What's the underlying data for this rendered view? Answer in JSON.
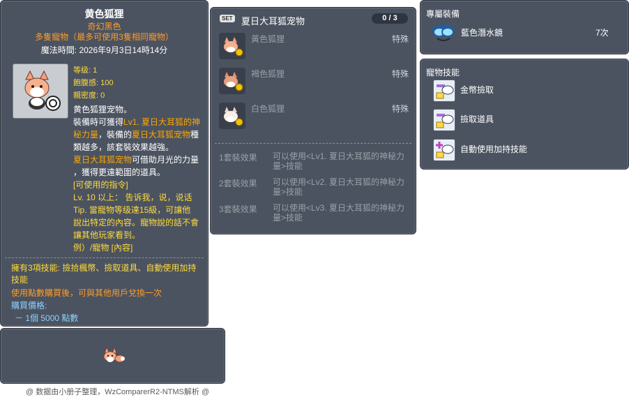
{
  "item_id": "05002251",
  "main": {
    "title": "黄色狐狸",
    "rarity": "奇幻黑色",
    "subtitle": "多隻寵物（最多可使用3隻相同寵物）",
    "magic_time": "魔法時間: 2026年9月3日14時14分",
    "stats": [
      "等级: 1",
      "飽腹感: 100",
      "親密度: 0"
    ],
    "desc": {
      "l1": "黄色狐狸宠物。",
      "l2a": "裝備時可獲得",
      "l2b": "Lv1. 夏日大耳狐的神",
      "l3a": "秘力量",
      "l3b": "，裝備的",
      "l3c": "夏日大耳狐宠物",
      "l3d": "種",
      "l4": "類越多，該套裝效果越強。",
      "l5a": "夏日大耳狐宠物",
      "l5b": "可借助月光的力量",
      "l6": "，獲得更遠範圍的道具。",
      "l7": "[可使用的指令]",
      "l8": "Lv. 10 以上： 告诉我，说，说话",
      "l9": "Tip. 當寵物等级達15級，可讓他",
      "l10": "說出特定的內容。寵物說的話不會",
      "l11": "讓其他玩家看到。",
      "l12": "例）/寵物 [內容]"
    },
    "skills_line1": "擁有3項技能: 撿拾楓幣、撿取道具、自動使用加持",
    "skills_line2": "技能",
    "note": "使用點數購買後，可與其他用戶兌換一次",
    "price_label": "購買價格:",
    "price_value": "－ 1個 5000 點數"
  },
  "credit": "@ 数据由小册子整理，WzComparerR2-NTMS解析 @",
  "set": {
    "tag": "SET",
    "name": "夏日大耳狐宠物",
    "count": "0 / 3",
    "items": [
      {
        "name": "黃色狐狸",
        "type": "特殊"
      },
      {
        "name": "褐色狐狸",
        "type": "特殊"
      },
      {
        "name": "白色狐狸",
        "type": "特殊"
      }
    ],
    "effects": [
      {
        "label": "1套裝效果",
        "text": "可以使用<Lv1. 夏日大耳狐的神秘力量>技能"
      },
      {
        "label": "2套裝效果",
        "text": "可以使用<Lv2. 夏日大耳狐的神秘力量>技能"
      },
      {
        "label": "3套裝效果",
        "text": "可以使用<Lv3. 夏日大耳狐的神秘力量>技能"
      }
    ]
  },
  "exclusive": {
    "header": "專屬裝備",
    "item_name": "藍色潛水鏡",
    "item_count": "7次"
  },
  "skills": {
    "header": "寵物技能",
    "items": [
      "金幣撿取",
      "撿取道具",
      "自動使用加持技能"
    ]
  },
  "colors": {
    "panel_bg": "#4b5360",
    "orange": "#ff9b28",
    "yellow": "#ffda3c",
    "price_blue": "#8fd0ff"
  }
}
